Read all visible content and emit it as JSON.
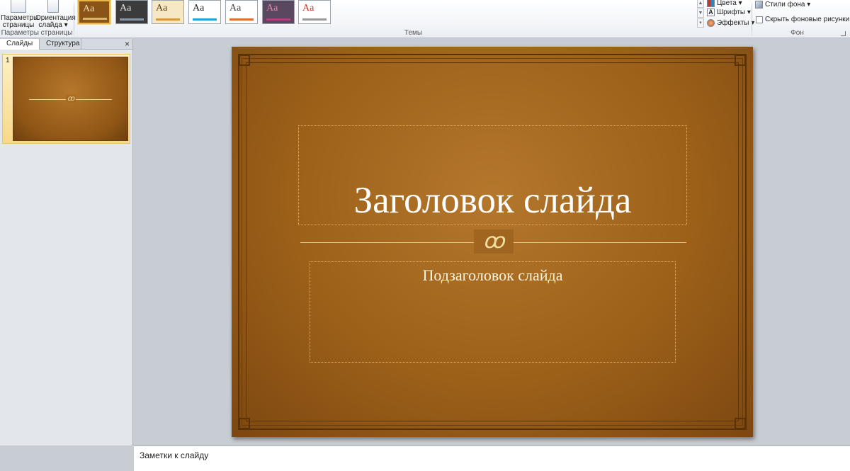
{
  "ribbon": {
    "page_setup": {
      "group_label": "Параметры страницы",
      "page_params_label": "Параметры\nстраницы",
      "orientation_label": "Ориентация\nслайда ▾"
    },
    "themes": {
      "group_label": "Темы",
      "items": [
        {
          "label": "Aa",
          "bg": "#8a5418",
          "fg": "#f2deaa",
          "bar": "#d8b56a",
          "selected": true
        },
        {
          "label": "Aa",
          "bg": "#3b3b3b",
          "fg": "#e8e8e8",
          "bar": "#8899aa",
          "selected": false
        },
        {
          "label": "Aa",
          "bg": "#f6e7c5",
          "fg": "#5a3b10",
          "bar": "#d49a40",
          "selected": false
        },
        {
          "label": "Aa",
          "bg": "#ffffff",
          "fg": "#1a1a1a",
          "bar": "#2aa0d8",
          "selected": false
        },
        {
          "label": "Aa",
          "bg": "#ffffff",
          "fg": "#444444",
          "bar": "#e07030",
          "selected": false
        },
        {
          "label": "Aa",
          "bg": "#5a4860",
          "fg": "#e28ab0",
          "bar": "#b04080",
          "selected": false
        },
        {
          "label": "Aa",
          "bg": "#ffffff",
          "fg": "#c03a2a",
          "bar": "#999999",
          "selected": false
        }
      ],
      "colors_label": "Цвета ▾",
      "fonts_label": "Шрифты ▾",
      "effects_label": "Эффекты ▾"
    },
    "background": {
      "group_label": "Фон",
      "styles_label": "Стили фона ▾",
      "hide_label": "Скрыть фоновые рисунки"
    }
  },
  "left_panel": {
    "tab_slides": "Слайды",
    "tab_outline": "Структура",
    "close": "×",
    "thumb_number": "1",
    "thumb_ornament": "ꝏ"
  },
  "slide": {
    "title": "Заголовок слайда",
    "subtitle": "Подзаголовок слайда",
    "ornament": "ꝏ"
  },
  "notes": {
    "placeholder": "Заметки к слайду"
  }
}
